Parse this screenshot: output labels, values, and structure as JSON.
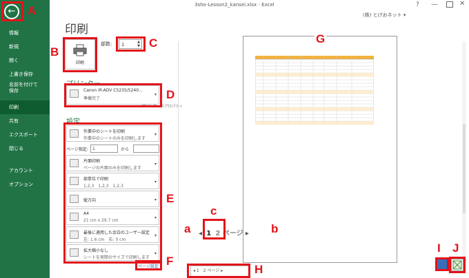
{
  "window_title": "3sho-Lesson2_kansei.xlsx - Excel",
  "title_controls": {
    "help": "?",
    "minimize": "—",
    "close": "✕"
  },
  "account": "(株) とげおネット ▾",
  "sidebar": {
    "back_icon": "←",
    "items": [
      {
        "label": "情報"
      },
      {
        "label": "新規"
      },
      {
        "label": "開く"
      },
      {
        "label": "上書き保存"
      },
      {
        "label": "名前を付けて保存"
      },
      {
        "label": "印刷"
      },
      {
        "label": "共有"
      },
      {
        "label": "エクスポート"
      },
      {
        "label": "閉じる"
      },
      {
        "label": "アカウント"
      },
      {
        "label": "オプション"
      }
    ]
  },
  "print": {
    "title": "印刷",
    "button_label": "印刷",
    "copies_label": "部数:",
    "copies_value": "1",
    "printer_heading": "プリンター",
    "printer_name": "Canon iR-ADV C5235/5240…",
    "printer_status": "準備完了",
    "printer_properties": "プリンターのプロパティ",
    "settings_heading": "設定",
    "settings": [
      {
        "line1": "作業中のシートを印刷",
        "line2": "作業中のシートのみを印刷します"
      },
      {
        "line1": "片面印刷",
        "line2": "ページの片面のみを印刷します"
      },
      {
        "line1": "部単位で印刷",
        "line2": "1,2,3　1,2,3　1,2,3"
      },
      {
        "line1": "縦方向",
        "line2": ""
      },
      {
        "line1": "A4",
        "line2": "21 cm x 29.7 cm"
      },
      {
        "line1": "最後に適用した余白のユーザー設定",
        "line2": "左: 1.6 cm　右: 0 cm"
      },
      {
        "line1": "拡大縮小なし",
        "line2": "シートを実際のサイズで印刷します"
      }
    ],
    "pages_label": "ページ指定:",
    "pages_from": "1",
    "pages_to_label": "から",
    "page_setup_link": "ページ設定"
  },
  "preview": {
    "nav_current": "1",
    "nav_total": "2 ページ",
    "bottom_nav": "◂ 1　2 ページ ▸"
  },
  "callouts": {
    "A": "A",
    "B": "B",
    "C": "C",
    "D": "D",
    "E": "E",
    "F": "F",
    "G": "G",
    "H": "H",
    "I": "I",
    "J": "J",
    "a": "a",
    "b": "b",
    "c": "c"
  },
  "colors": {
    "excel_green": "#217346",
    "callout_red": "#e3131a"
  }
}
